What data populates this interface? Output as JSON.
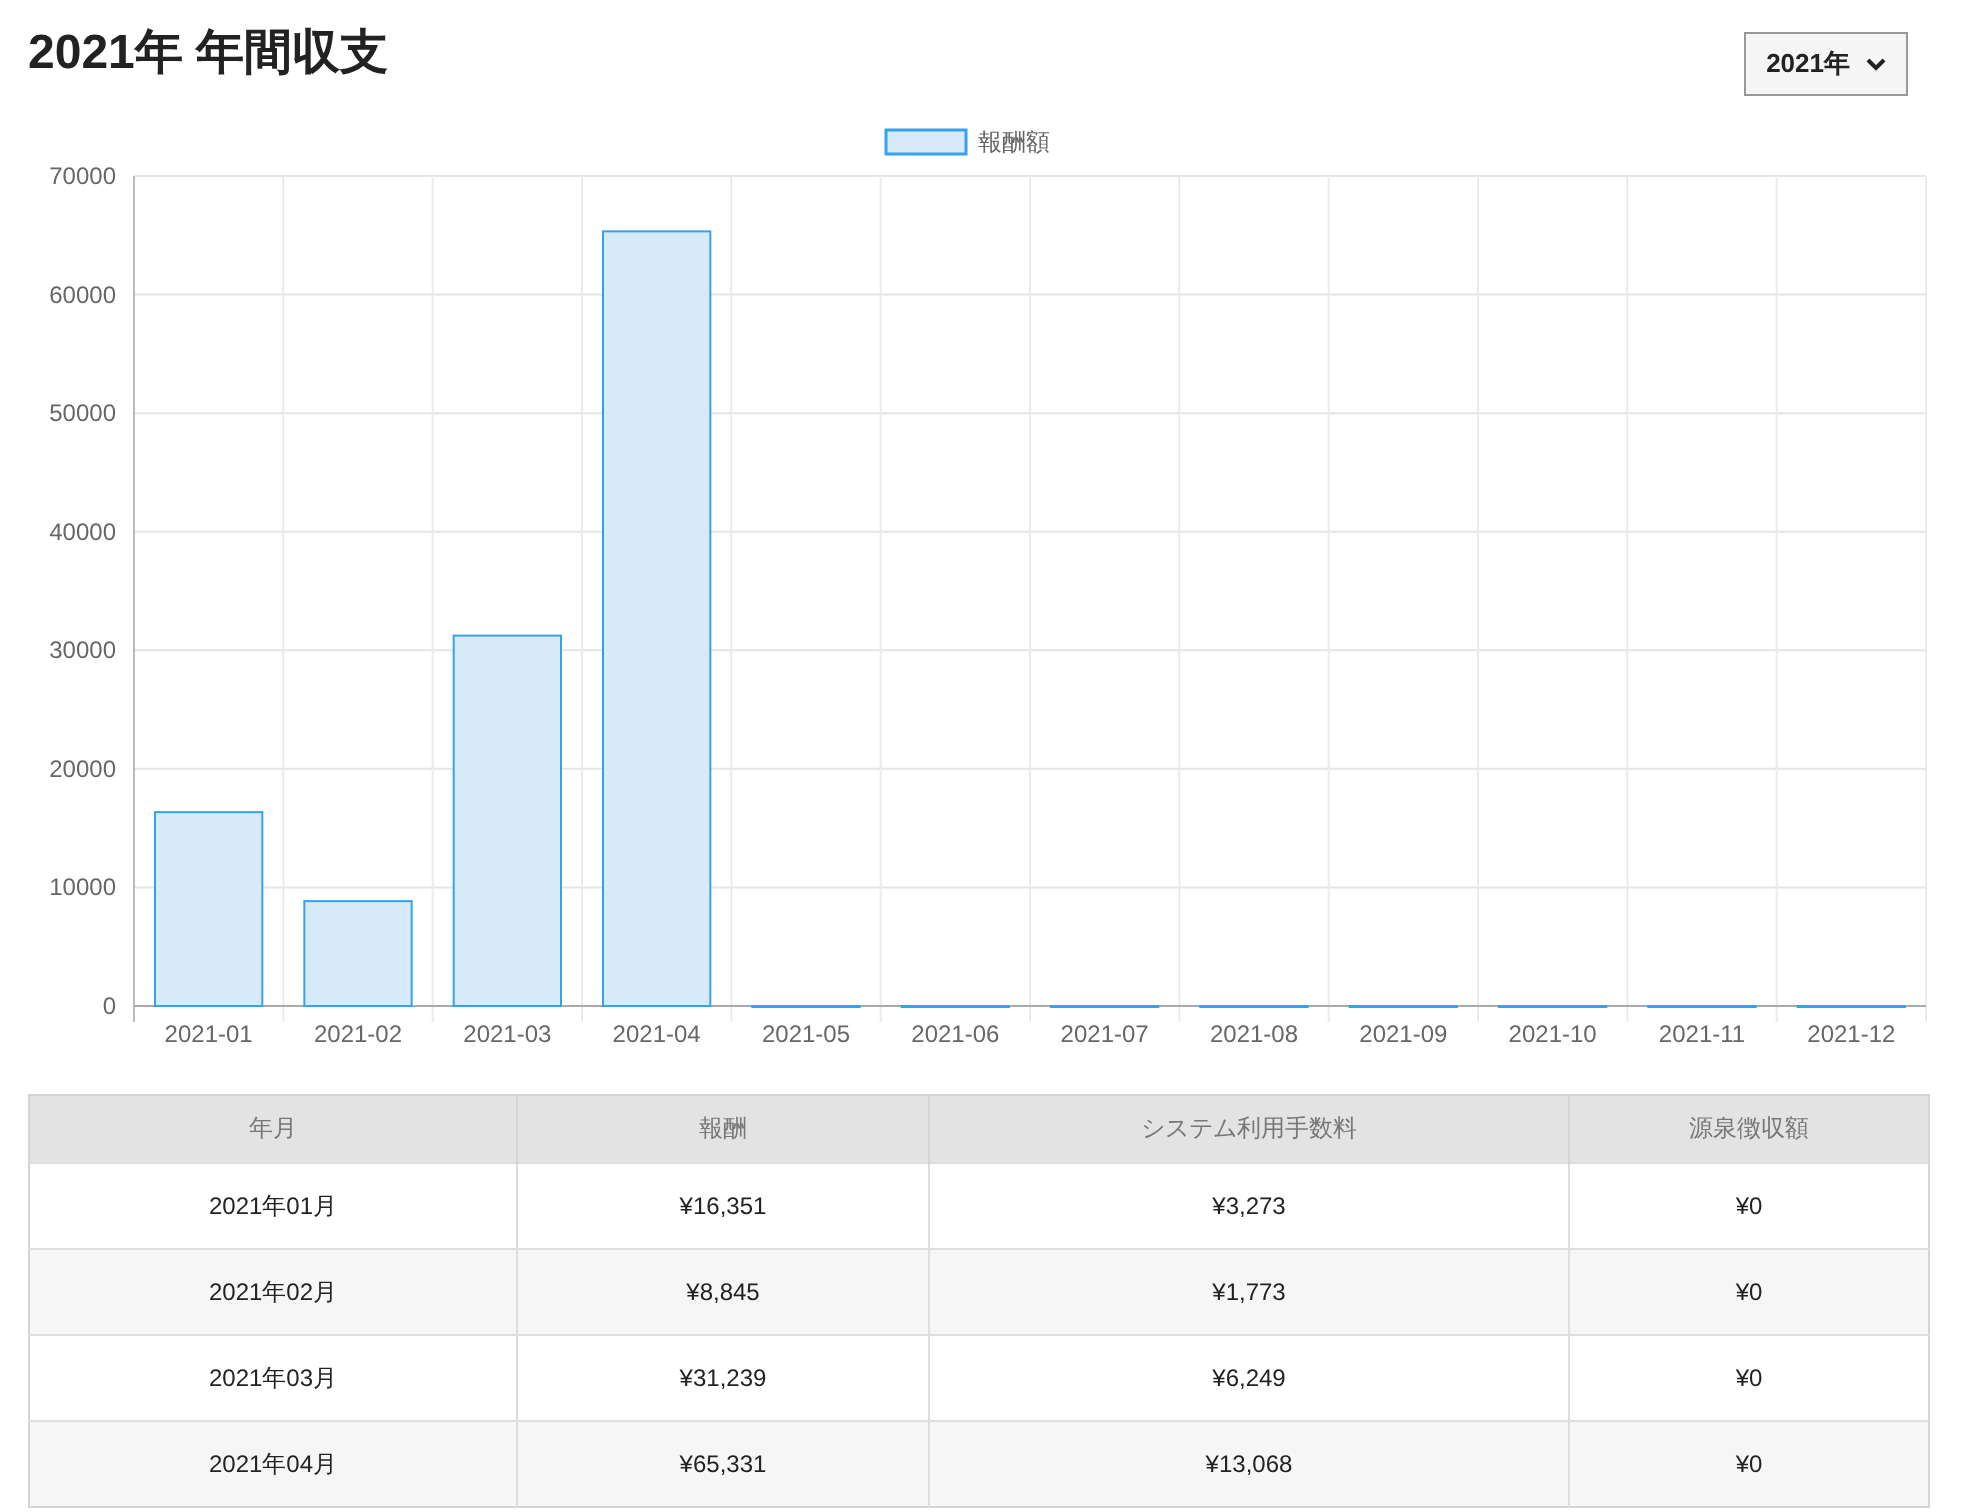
{
  "title": "2021年 年間収支",
  "year_select": {
    "value": "2021年"
  },
  "chart": {
    "chart_data": {
      "type": "bar",
      "categories": [
        "2021-01",
        "2021-02",
        "2021-03",
        "2021-04",
        "2021-05",
        "2021-06",
        "2021-07",
        "2021-08",
        "2021-09",
        "2021-10",
        "2021-11",
        "2021-12"
      ],
      "series": [
        {
          "name": "報酬額",
          "color": "#36a2eb",
          "values": [
            16351,
            8845,
            31239,
            65331,
            0,
            0,
            0,
            0,
            0,
            0,
            0,
            0
          ]
        }
      ],
      "grid": true,
      "ylim": [
        0,
        70000
      ],
      "yticks": [
        0,
        10000,
        20000,
        30000,
        40000,
        50000,
        60000,
        70000
      ]
    }
  },
  "table": {
    "columns": [
      "年月",
      "報酬",
      "システム利用手数料",
      "源泉徴収額"
    ],
    "rows": [
      [
        "2021年01月",
        "¥16,351",
        "¥3,273",
        "¥0"
      ],
      [
        "2021年02月",
        "¥8,845",
        "¥1,773",
        "¥0"
      ],
      [
        "2021年03月",
        "¥31,239",
        "¥6,249",
        "¥0"
      ],
      [
        "2021年04月",
        "¥65,331",
        "¥13,068",
        "¥0"
      ]
    ]
  }
}
